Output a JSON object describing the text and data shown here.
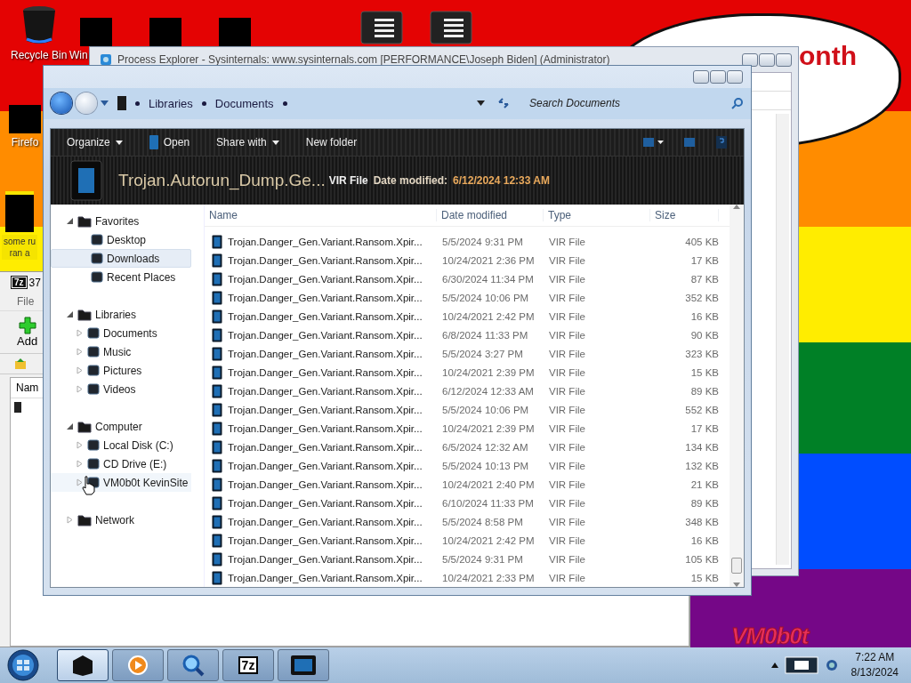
{
  "desktop": {
    "top_icons": [
      {
        "kind": "bin",
        "label": "Recycle Bin"
      },
      {
        "kind": "blocked",
        "label": "Win"
      },
      {
        "kind": "blocked"
      },
      {
        "kind": "blocked"
      },
      {
        "kind": "menu"
      },
      {
        "kind": "menu"
      }
    ],
    "side_icons": [
      {
        "kind": "blocked",
        "label": "Firefo"
      },
      {
        "kind": "note",
        "label_lines": [
          "some ru",
          "ran a"
        ]
      }
    ],
    "bubble_text": "onth",
    "wallpaper_text": "VM0b0t"
  },
  "seven_zip": {
    "logo": "7z",
    "title": "37",
    "menu": [
      "File"
    ],
    "toolbar": [
      "Add"
    ],
    "column": "Nam"
  },
  "process_explorer": {
    "title": "Process Explorer - Sysinternals: www.sysinternals.com [PERFORMANCE\\Joseph Biden] (Administrator)"
  },
  "explorer": {
    "breadcrumb": [
      "Libraries",
      "Documents"
    ],
    "search": {
      "placeholder": "Search Documents"
    },
    "toolbar": [
      {
        "kind": "menu",
        "label": "Organize"
      },
      {
        "kind": "file-action",
        "label": "Open"
      },
      {
        "kind": "menu",
        "label": "Share with"
      },
      {
        "kind": "plain",
        "label": "New folder"
      }
    ],
    "details": {
      "name": "Trojan.Autorun_Dump.Ge...",
      "type": "VIR File",
      "date_label": "Date modified:",
      "date": "6/12/2024 12:33 AM"
    },
    "nav": [
      {
        "label": "Favorites",
        "expanded": true,
        "selected": false,
        "hovered": false,
        "children": [
          {
            "label": "Desktop",
            "selected": false,
            "hovered": false
          },
          {
            "label": "Downloads",
            "selected": true,
            "hovered": false
          },
          {
            "label": "Recent Places",
            "selected": false,
            "hovered": false
          }
        ]
      },
      {
        "label": "Libraries",
        "expanded": true,
        "selected": false,
        "hovered": false,
        "children": [
          {
            "label": "Documents",
            "expanded": false,
            "selected": false,
            "hovered": false
          },
          {
            "label": "Music",
            "expanded": false,
            "selected": false,
            "hovered": false
          },
          {
            "label": "Pictures",
            "expanded": false,
            "selected": false,
            "hovered": false
          },
          {
            "label": "Videos",
            "expanded": false,
            "selected": false,
            "hovered": false
          }
        ]
      },
      {
        "label": "Computer",
        "expanded": true,
        "selected": false,
        "hovered": false,
        "children": [
          {
            "label": "Local Disk (C:)",
            "expanded": false,
            "selected": false,
            "hovered": false
          },
          {
            "label": "CD Drive (E:)",
            "expanded": false,
            "selected": false,
            "hovered": false
          },
          {
            "label": "VM0b0t KevinSite",
            "expanded": false,
            "selected": false,
            "hovered": true
          }
        ]
      },
      {
        "label": "Network",
        "expanded": false,
        "selected": false,
        "hovered": false
      }
    ],
    "columns": [
      "Name",
      "Date modified",
      "Type",
      "Size"
    ],
    "rows": [
      {
        "name": "Trojan.Danger_Gen.Variant.Ransom.Xpir...",
        "date": "5/5/2024 9:31 PM",
        "type": "VIR File",
        "size": "405 KB"
      },
      {
        "name": "Trojan.Danger_Gen.Variant.Ransom.Xpir...",
        "date": "10/24/2021 2:36 PM",
        "type": "VIR File",
        "size": "17 KB"
      },
      {
        "name": "Trojan.Danger_Gen.Variant.Ransom.Xpir...",
        "date": "6/30/2024 11:34 PM",
        "type": "VIR File",
        "size": "87 KB"
      },
      {
        "name": "Trojan.Danger_Gen.Variant.Ransom.Xpir...",
        "date": "5/5/2024 10:06 PM",
        "type": "VIR File",
        "size": "352 KB"
      },
      {
        "name": "Trojan.Danger_Gen.Variant.Ransom.Xpir...",
        "date": "10/24/2021 2:42 PM",
        "type": "VIR File",
        "size": "16 KB"
      },
      {
        "name": "Trojan.Danger_Gen.Variant.Ransom.Xpir...",
        "date": "6/8/2024 11:33 PM",
        "type": "VIR File",
        "size": "90 KB"
      },
      {
        "name": "Trojan.Danger_Gen.Variant.Ransom.Xpir...",
        "date": "5/5/2024 3:27 PM",
        "type": "VIR File",
        "size": "323 KB"
      },
      {
        "name": "Trojan.Danger_Gen.Variant.Ransom.Xpir...",
        "date": "10/24/2021 2:39 PM",
        "type": "VIR File",
        "size": "15 KB"
      },
      {
        "name": "Trojan.Danger_Gen.Variant.Ransom.Xpir...",
        "date": "6/12/2024 12:33 AM",
        "type": "VIR File",
        "size": "89 KB"
      },
      {
        "name": "Trojan.Danger_Gen.Variant.Ransom.Xpir...",
        "date": "5/5/2024 10:06 PM",
        "type": "VIR File",
        "size": "552 KB"
      },
      {
        "name": "Trojan.Danger_Gen.Variant.Ransom.Xpir...",
        "date": "10/24/2021 2:39 PM",
        "type": "VIR File",
        "size": "17 KB"
      },
      {
        "name": "Trojan.Danger_Gen.Variant.Ransom.Xpir...",
        "date": "6/5/2024 12:32 AM",
        "type": "VIR File",
        "size": "134 KB"
      },
      {
        "name": "Trojan.Danger_Gen.Variant.Ransom.Xpir...",
        "date": "5/5/2024 10:13 PM",
        "type": "VIR File",
        "size": "132 KB"
      },
      {
        "name": "Trojan.Danger_Gen.Variant.Ransom.Xpir...",
        "date": "10/24/2021 2:40 PM",
        "type": "VIR File",
        "size": "21 KB"
      },
      {
        "name": "Trojan.Danger_Gen.Variant.Ransom.Xpir...",
        "date": "6/10/2024 11:33 PM",
        "type": "VIR File",
        "size": "89 KB"
      },
      {
        "name": "Trojan.Danger_Gen.Variant.Ransom.Xpir...",
        "date": "5/5/2024 8:58 PM",
        "type": "VIR File",
        "size": "348 KB"
      },
      {
        "name": "Trojan.Danger_Gen.Variant.Ransom.Xpir...",
        "date": "10/24/2021 2:42 PM",
        "type": "VIR File",
        "size": "16 KB"
      },
      {
        "name": "Trojan.Danger_Gen.Variant.Ransom.Xpir...",
        "date": "5/5/2024 9:31 PM",
        "type": "VIR File",
        "size": "105 KB"
      },
      {
        "name": "Trojan.Danger_Gen.Variant.Ransom.Xpir...",
        "date": "10/24/2021 2:33 PM",
        "type": "VIR File",
        "size": "15 KB"
      }
    ]
  },
  "taskbar": {
    "buttons": [
      {
        "kind": "box",
        "selected": true
      },
      {
        "kind": "media",
        "selected": false
      },
      {
        "kind": "search",
        "selected": false
      },
      {
        "kind": "archive",
        "label": "7z",
        "selected": false
      },
      {
        "kind": "screen",
        "selected": false
      }
    ],
    "clock": {
      "time": "7:22 AM",
      "date": "8/13/2024"
    }
  }
}
